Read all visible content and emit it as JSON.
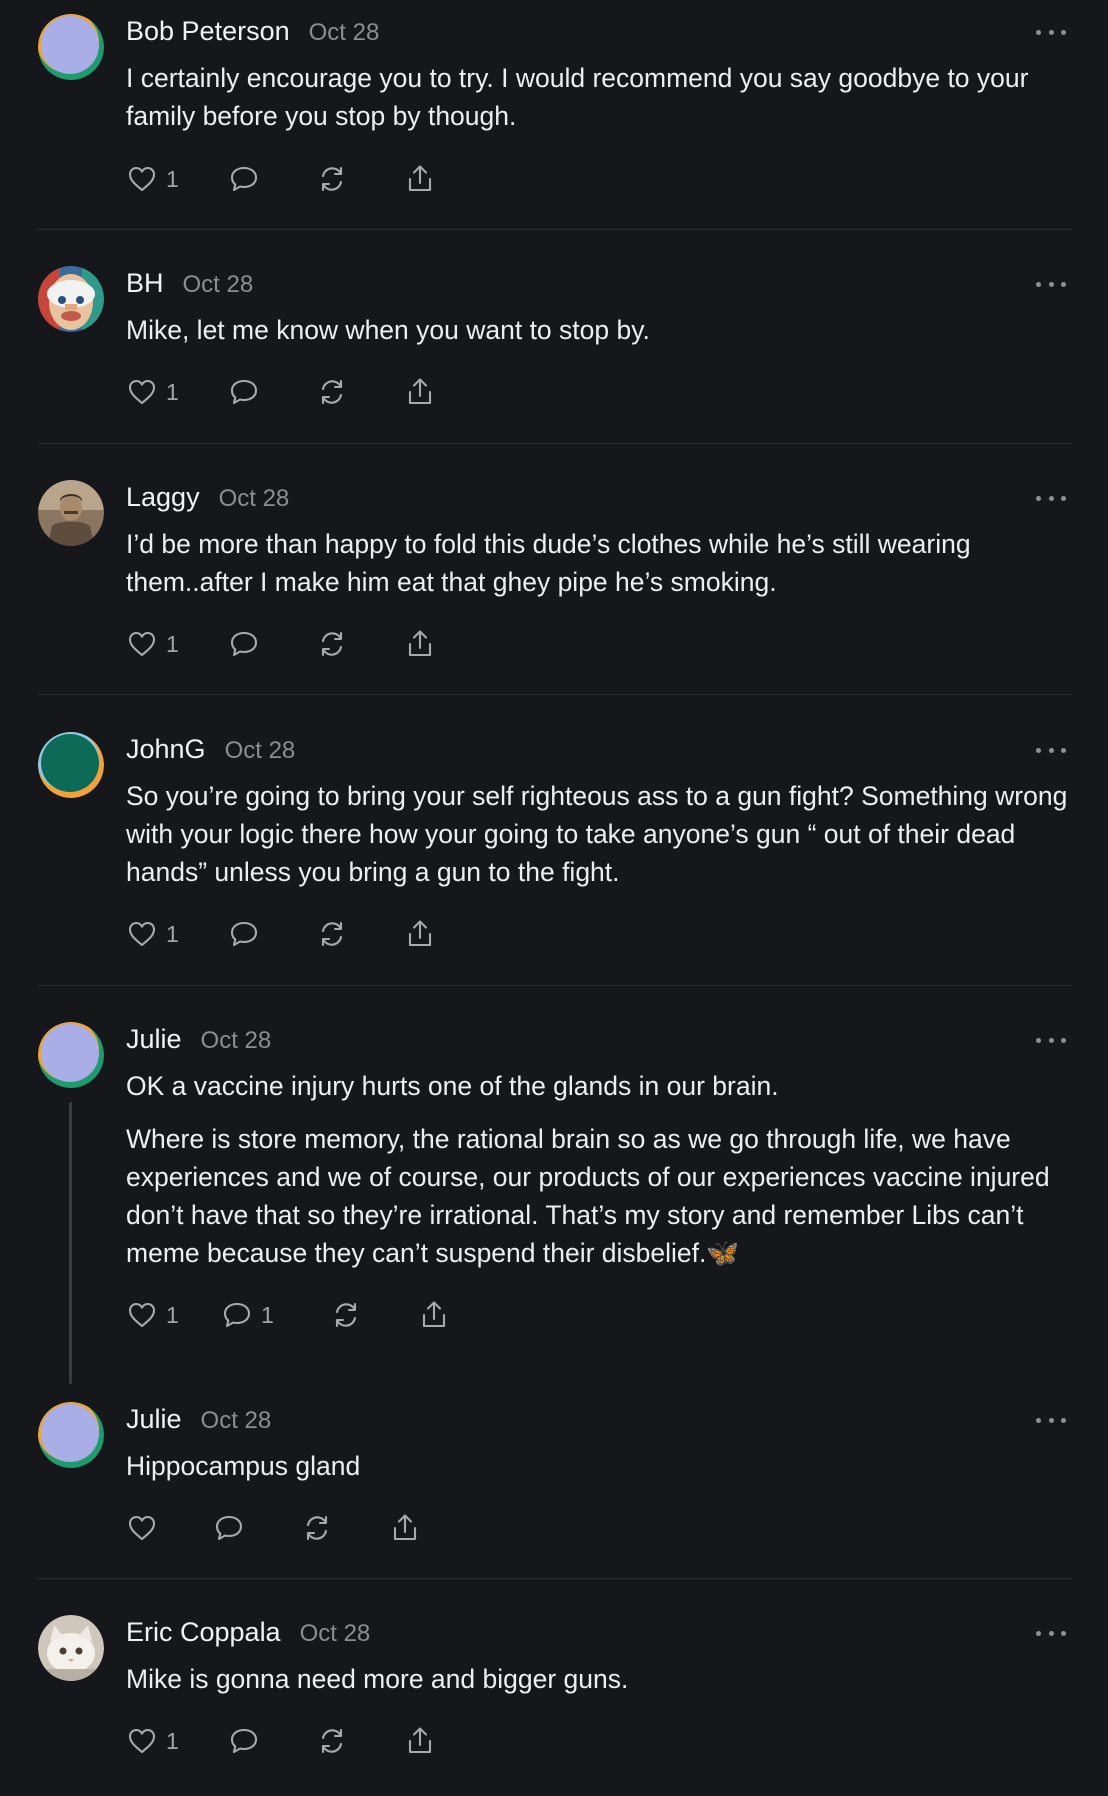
{
  "comments": [
    {
      "author": "Bob Peterson",
      "date": "Oct 28",
      "avatar": "pastel-purple-ring-avatar",
      "paragraphs": [
        "I certainly encourage you to try. I would recommend you say goodbye to your family before you stop by though."
      ],
      "likes": "1",
      "replies": ""
    },
    {
      "author": "BH",
      "date": "Oct 28",
      "avatar": "colorful-painted-face-avatar",
      "paragraphs": [
        "Mike, let me know when you want to stop by."
      ],
      "likes": "1",
      "replies": ""
    },
    {
      "author": "Laggy",
      "date": "Oct 28",
      "avatar": "sepia-portrait-avatar",
      "paragraphs": [
        "I’d be more than happy to fold this dude’s clothes while he’s still wearing them..after I make him eat that ghey pipe he’s smoking."
      ],
      "likes": "1",
      "replies": ""
    },
    {
      "author": "JohnG",
      "date": "Oct 28",
      "avatar": "teal-ring-avatar",
      "paragraphs": [
        "So you’re going to bring your self righteous ass to a gun fight? Something wrong with your logic there how your going to take anyone’s gun “ out of their dead hands” unless you bring a gun to the fight."
      ],
      "likes": "1",
      "replies": ""
    },
    {
      "author": "Julie",
      "date": "Oct 28",
      "avatar": "pastel-purple-ring-avatar",
      "paragraphs": [
        "OK a vaccine injury hurts one of the glands in our brain.",
        "Where is store memory, the rational brain so as we go through life, we have experiences and we of course, our products of our experiences vaccine injured don’t have that so they’re irrational. That’s my story and remember Libs can’t meme because they can’t suspend their disbelief.🦋"
      ],
      "likes": "1",
      "replies": "1"
    },
    {
      "author": "Julie",
      "date": "Oct 28",
      "avatar": "pastel-purple-ring-avatar",
      "paragraphs": [
        "Hippocampus gland"
      ],
      "likes": "",
      "replies": ""
    },
    {
      "author": "Eric Coppala",
      "date": "Oct 28",
      "avatar": "white-cat-avatar",
      "paragraphs": [
        "Mike is gonna need more and bigger guns."
      ],
      "likes": "1",
      "replies": ""
    }
  ],
  "icons": {
    "like": "heart-icon",
    "reply": "comment-bubble-icon",
    "restack": "restack-icon",
    "share": "share-icon",
    "more": "more-dots-icon"
  },
  "colors": {
    "background": "#16171b",
    "text": "#eeeef0",
    "muted": "#8c8d93",
    "divider": "#2c2d32"
  }
}
